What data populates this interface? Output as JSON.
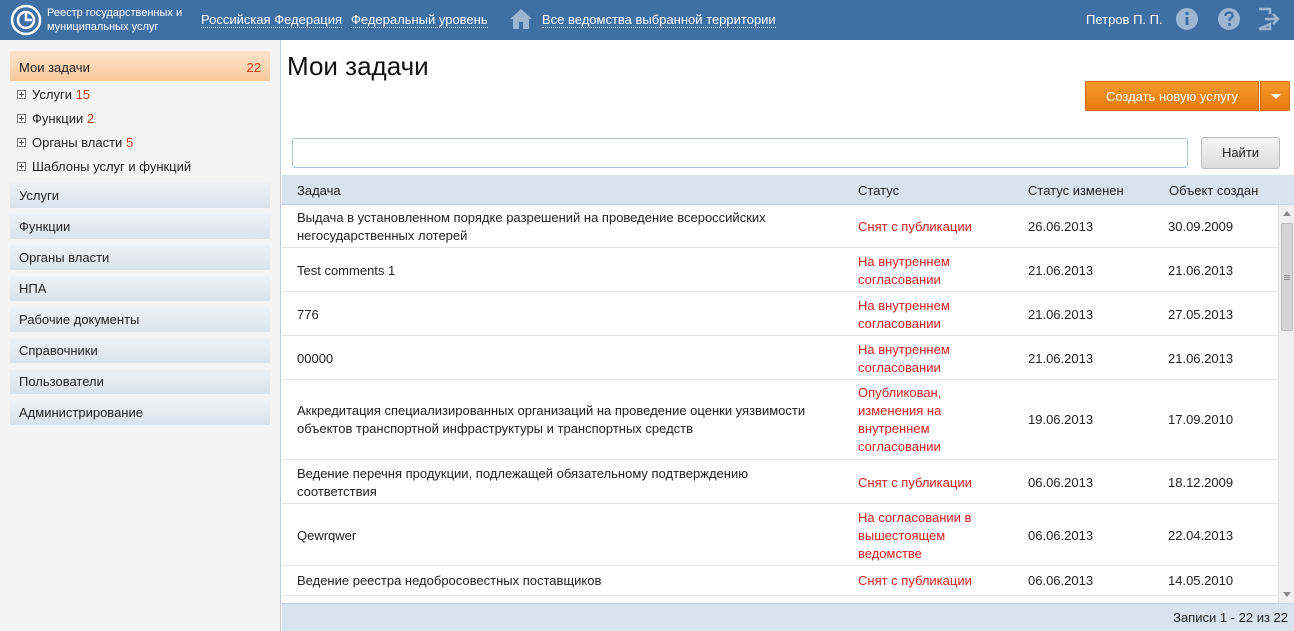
{
  "header": {
    "brand_line1": "Реестр государственных и",
    "brand_line2": "муниципальных услуг",
    "nav_region": "Российская Федерация",
    "nav_level": "Федеральный уровень",
    "nav_departments": "Все ведомства выбранной территории",
    "user_name": "Петров П. П."
  },
  "sidebar": {
    "active": {
      "label": "Мои задачи",
      "count": "22"
    },
    "subitems": [
      {
        "label": "Услуги",
        "count": "15"
      },
      {
        "label": "Функции",
        "count": "2"
      },
      {
        "label": "Органы власти",
        "count": "5"
      },
      {
        "label": "Шаблоны услуг и функций",
        "count": ""
      }
    ],
    "sections": [
      "Услуги",
      "Функции",
      "Органы власти",
      "НПА",
      "Рабочие документы",
      "Справочники",
      "Пользователи",
      "Администрирование"
    ]
  },
  "main": {
    "title": "Мои задачи",
    "create_button": "Создать новую услугу",
    "search_placeholder": "",
    "find_button": "Найти",
    "records": "Записи 1 - 22 из 22"
  },
  "table": {
    "columns": [
      "Задача",
      "Статус",
      "Статус изменен",
      "Объект создан"
    ],
    "rows": [
      {
        "task": "Выдача в установленном порядке разрешений на проведение всероссийских негосударственных лотерей",
        "status": "Снят с публикации",
        "changed": "26.06.2013",
        "created": "30.09.2009"
      },
      {
        "task": "Test comments 1",
        "status": "На внутреннем согласовании",
        "changed": "21.06.2013",
        "created": "21.06.2013"
      },
      {
        "task": "776",
        "status": "На внутреннем согласовании",
        "changed": "21.06.2013",
        "created": "27.05.2013"
      },
      {
        "task": "00000",
        "status": "На внутреннем согласовании",
        "changed": "21.06.2013",
        "created": "21.06.2013"
      },
      {
        "task": "Аккредитация специализированных организаций на проведение оценки уязвимости объектов транспортной инфраструктуры и транспортных средств",
        "status": "Опубликован, изменения на внутреннем согласовании",
        "changed": "19.06.2013",
        "created": "17.09.2010"
      },
      {
        "task": "Ведение перечня продукции, подлежащей обязательному подтверждению соответствия",
        "status": "Снят с публикации",
        "changed": "06.06.2013",
        "created": "18.12.2009"
      },
      {
        "task": "Qewrqwer",
        "status": "На согласовании в вышестоящем ведомстве",
        "changed": "06.06.2013",
        "created": "22.04.2013"
      },
      {
        "task": "Ведение реестра недобросовестных поставщиков",
        "status": "Снят с публикации",
        "changed": "06.06.2013",
        "created": "14.05.2010"
      }
    ]
  },
  "colors": {
    "header": "#3f6fa3",
    "accent": "#e87a0d",
    "status_red": "#d71f1f"
  },
  "icons": [
    "logo-icon",
    "home-icon",
    "info-icon",
    "help-icon",
    "logout-icon"
  ]
}
